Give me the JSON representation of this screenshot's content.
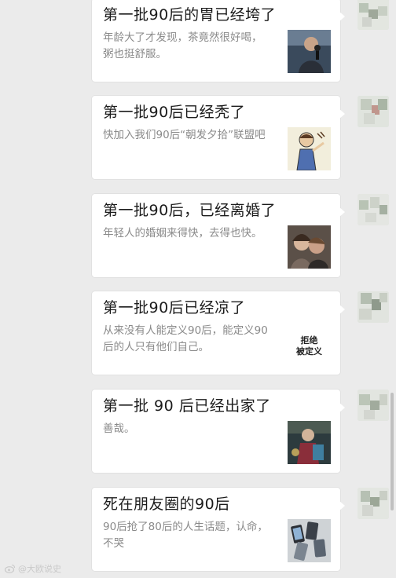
{
  "messages": [
    {
      "title": "第一批90后的胃已经垮了",
      "desc": "年龄大了才发现，茶竟然很好喝，粥也挺舒服。",
      "thumb": "photo-man-microphone"
    },
    {
      "title": "第一批90后已经秃了",
      "desc": "快加入我们90后“朝发夕拾”联盟吧",
      "thumb": "cartoon-man-hair"
    },
    {
      "title": "第一批90后，已经离婚了",
      "desc": "年轻人的婚姻来得快，去得也快。",
      "thumb": "photo-couple"
    },
    {
      "title": "第一批90后已经凉了",
      "desc": "从来没有人能定义90后，能定义90后的人只有他们自己。",
      "thumb": "text-graphic",
      "thumb_text_line1": "拒绝",
      "thumb_text_line2": "被定义"
    },
    {
      "title": "第一批 90 后已经出家了",
      "desc": "善哉。",
      "thumb": "photo-monk"
    },
    {
      "title": "死在朋友圈的90后",
      "desc": "90后抢了80后的人生话题，认命，不哭",
      "thumb": "photo-phones"
    }
  ],
  "avatar_icon": "blurred-avatar",
  "watermark": {
    "icon": "weibo-icon",
    "text": "@大欧说史"
  },
  "colors": {
    "background": "#ebebeb",
    "bubble": "#ffffff",
    "title": "#1b1b1b",
    "desc": "#8a8a8a"
  }
}
